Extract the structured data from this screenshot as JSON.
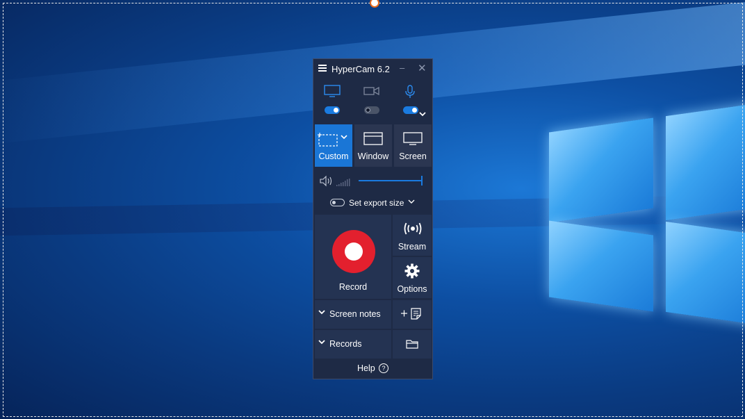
{
  "app": {
    "title": "HyperCam 6.2",
    "minimize_glyph": "–",
    "close_glyph": "✕"
  },
  "sources": [
    {
      "name": "monitor-icon",
      "enabled": true
    },
    {
      "name": "webcam-icon",
      "enabled": false
    },
    {
      "name": "microphone-icon",
      "enabled": true
    }
  ],
  "modes": {
    "custom": "Custom",
    "window": "Window",
    "screen": "Screen",
    "active": "custom"
  },
  "volume": {
    "level": 1.0
  },
  "export": {
    "label": "Set export size",
    "enabled": false
  },
  "actions": {
    "record": "Record",
    "stream": "Stream",
    "options": "Options",
    "screen_notes": "Screen notes",
    "records": "Records",
    "help": "Help",
    "help_glyph": "?"
  },
  "colors": {
    "accent": "#1a7be0",
    "record": "#e3202e",
    "panel": "#1e2a45"
  }
}
